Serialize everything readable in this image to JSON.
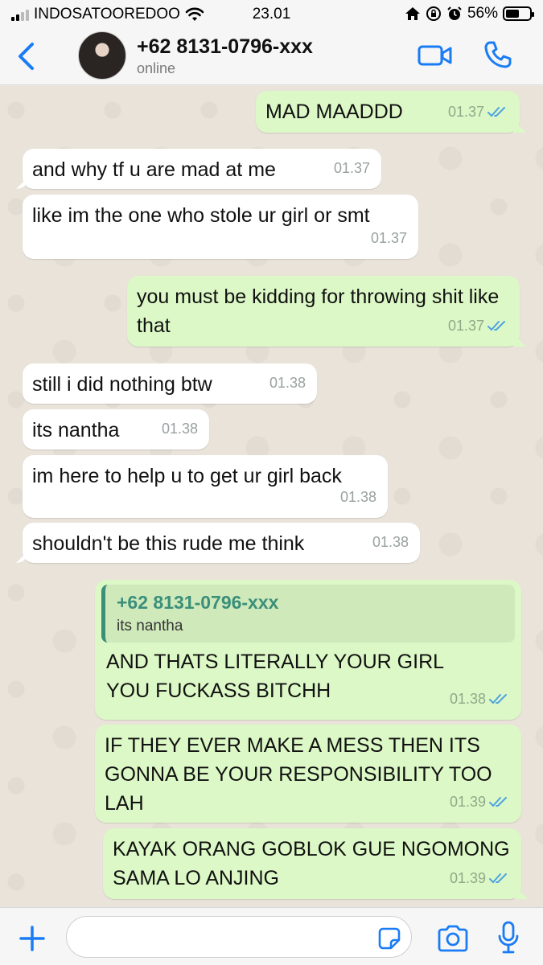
{
  "status_bar": {
    "carrier": "INDOSATOOREDOO",
    "time": "23.01",
    "battery": "56%",
    "battery_level": 0.56
  },
  "header": {
    "contact_name": "+62 8131-0796-xxx",
    "status": "online",
    "accent_color": "#1a7cf5"
  },
  "messages": [
    {
      "dir": "out",
      "text": "MAD MAADDD",
      "time": "01.37",
      "ticks": "read"
    },
    {
      "dir": "in",
      "text": "and why tf u are mad at me",
      "time": "01.37"
    },
    {
      "dir": "in",
      "text": "like im the one who stole ur girl or smt",
      "time": "01.37"
    },
    {
      "dir": "out",
      "text": "you must be kidding for throwing shit like that",
      "time": "01.37",
      "ticks": "read"
    },
    {
      "dir": "in",
      "text": "still i did nothing btw",
      "time": "01.38"
    },
    {
      "dir": "in",
      "text": "its nantha",
      "time": "01.38"
    },
    {
      "dir": "in",
      "text": "im here to help u to get ur girl back",
      "time": "01.38"
    },
    {
      "dir": "in",
      "text": "shouldn't be this rude me think",
      "time": "01.38"
    },
    {
      "dir": "out",
      "quote_author": "+62 8131-0796-xxx",
      "quote_text": "its nantha",
      "text": "AND THATS LITERALLY YOUR GIRL YOU FUCKASS BITCHH",
      "time": "01.38",
      "ticks": "read"
    },
    {
      "dir": "out",
      "text": "IF THEY EVER MAKE A MESS THEN ITS GONNA BE YOUR RESPONSIBILITY TOO LAH",
      "time": "01.39",
      "ticks": "read"
    },
    {
      "dir": "out",
      "text": "KAYAK ORANG GOBLOK GUE NGOMONG SAMA LO ANJING",
      "time": "01.39",
      "ticks": "read"
    }
  ],
  "input": {
    "placeholder": ""
  },
  "colors": {
    "outgoing_bubble": "#dcf8c6",
    "incoming_bubble": "#ffffff",
    "read_ticks": "#4fa3e0",
    "quote_accent": "#3b8f79"
  }
}
